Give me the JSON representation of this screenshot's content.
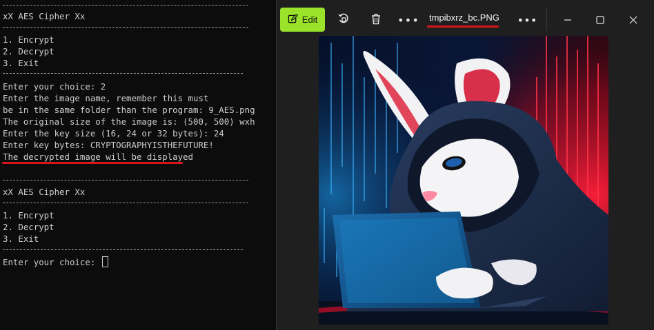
{
  "terminal": {
    "rule1": "----------------------------------------------",
    "header1": "xX AES Cipher Xx",
    "menu1": [
      "1. Encrypt",
      "2. Decrypt",
      "3. Exit"
    ],
    "prompt1": "Enter your choice: 2",
    "image_name_prompt_1": "Enter the image name, remember this must",
    "image_name_prompt_2": "be in the same folder than the program: 9_AES.png",
    "original_size": "The original size of the image is: (500, 500) wxh",
    "key_size_prompt": "Enter the key size (16, 24 or 32 bytes): 24",
    "key_bytes_prompt": "Enter key bytes: CRYPTOGRAPHYISTHEFUTURE!",
    "result_message": "The decrypted image will be displayed",
    "header2": "xX AES Cipher Xx",
    "menu2": [
      "1. Encrypt",
      "2. Decrypt",
      "3. Exit"
    ],
    "prompt2": "Enter your choice: "
  },
  "viewer": {
    "edit_label": "Edit",
    "file_name": "tmpibxrz_bc.PNG",
    "image_alt": "Hooded white rabbit typing on a laptop against a red and blue digital background"
  },
  "colors": {
    "terminal_bg": "#0c0c0c",
    "terminal_text": "#cccccc",
    "viewer_bg": "#1f1f1f",
    "edit_accent": "#9be32a",
    "annotation_red": "#d9141b"
  },
  "icons": {
    "edit": "edit-icon",
    "rotate": "rotate-icon",
    "delete": "trash-icon",
    "more": "more-icon",
    "minimize": "minimize-icon",
    "maximize": "maximize-icon",
    "close": "close-icon"
  }
}
